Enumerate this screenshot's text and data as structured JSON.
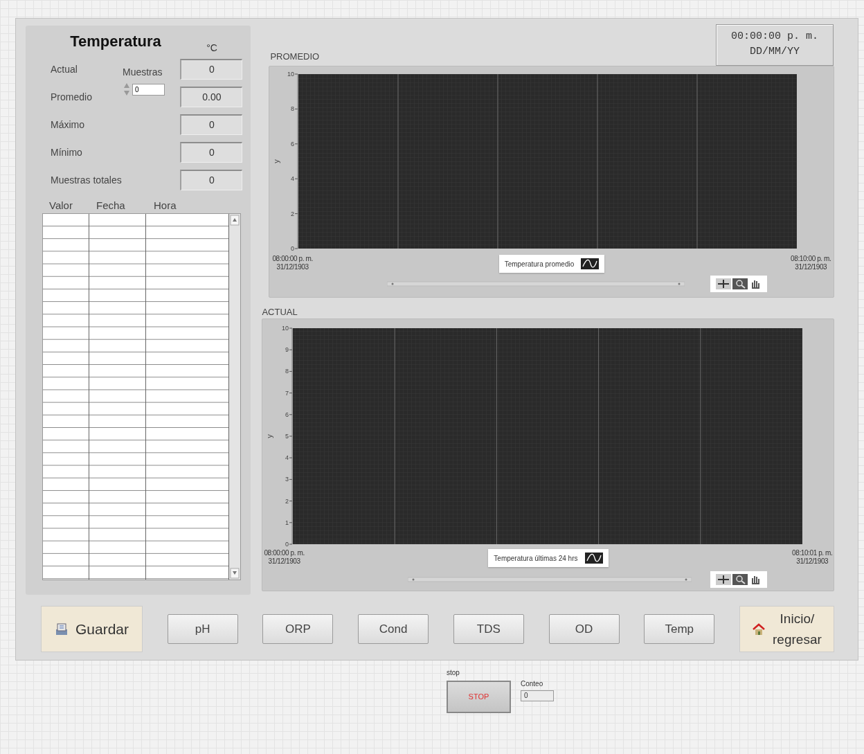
{
  "panel": {
    "title": "Temperatura",
    "unit": "°C",
    "readouts": [
      {
        "label": "Actual",
        "value": "0"
      },
      {
        "label": "Promedio",
        "value": "0.00"
      },
      {
        "label": "Máximo",
        "value": "0"
      },
      {
        "label": "Mínimo",
        "value": "0"
      },
      {
        "label": "Muestras totales",
        "value": "0"
      }
    ],
    "samples_control": {
      "label": "Muestras",
      "value": "0"
    },
    "table": {
      "columns": [
        "Valor",
        "Fecha",
        "Hora"
      ]
    }
  },
  "clock": {
    "time": "00:00:00 p. m.",
    "date": "DD/MM/YY"
  },
  "charts": [
    {
      "title": "PROMEDIO",
      "y_axis_label": "y",
      "y_tick_labels": [
        "10",
        "8",
        "6",
        "4",
        "2",
        "0"
      ],
      "x_labels": [
        "08:00:00 p. m.\n31/12/1903",
        "08:10:00 p. m.\n31/12/1903"
      ],
      "legend": "Temperatura promedio"
    },
    {
      "title": "ACTUAL",
      "y_axis_label": "y",
      "y_tick_labels": [
        "10",
        "9",
        "8",
        "7",
        "6",
        "5",
        "4",
        "3",
        "2",
        "1",
        "0"
      ],
      "x_labels": [
        "08:00:00 p. m.\n31/12/1903",
        "08:10:01 p. m.\n31/12/1903"
      ],
      "legend": "Temperatura últimas 24 hrs"
    }
  ],
  "buttons": [
    {
      "label": "Guardar",
      "kind": "save"
    },
    {
      "label": "pH",
      "kind": "plain"
    },
    {
      "label": "ORP",
      "kind": "plain"
    },
    {
      "label": "Cond",
      "kind": "plain"
    },
    {
      "label": "TDS",
      "kind": "plain"
    },
    {
      "label": "OD",
      "kind": "plain"
    },
    {
      "label": "Temp",
      "kind": "plain"
    },
    {
      "label": "Inicio/\nregresar",
      "kind": "home"
    }
  ],
  "stop": {
    "label": "stop",
    "button": "STOP"
  },
  "counter": {
    "label": "Conteo",
    "value": "0"
  }
}
